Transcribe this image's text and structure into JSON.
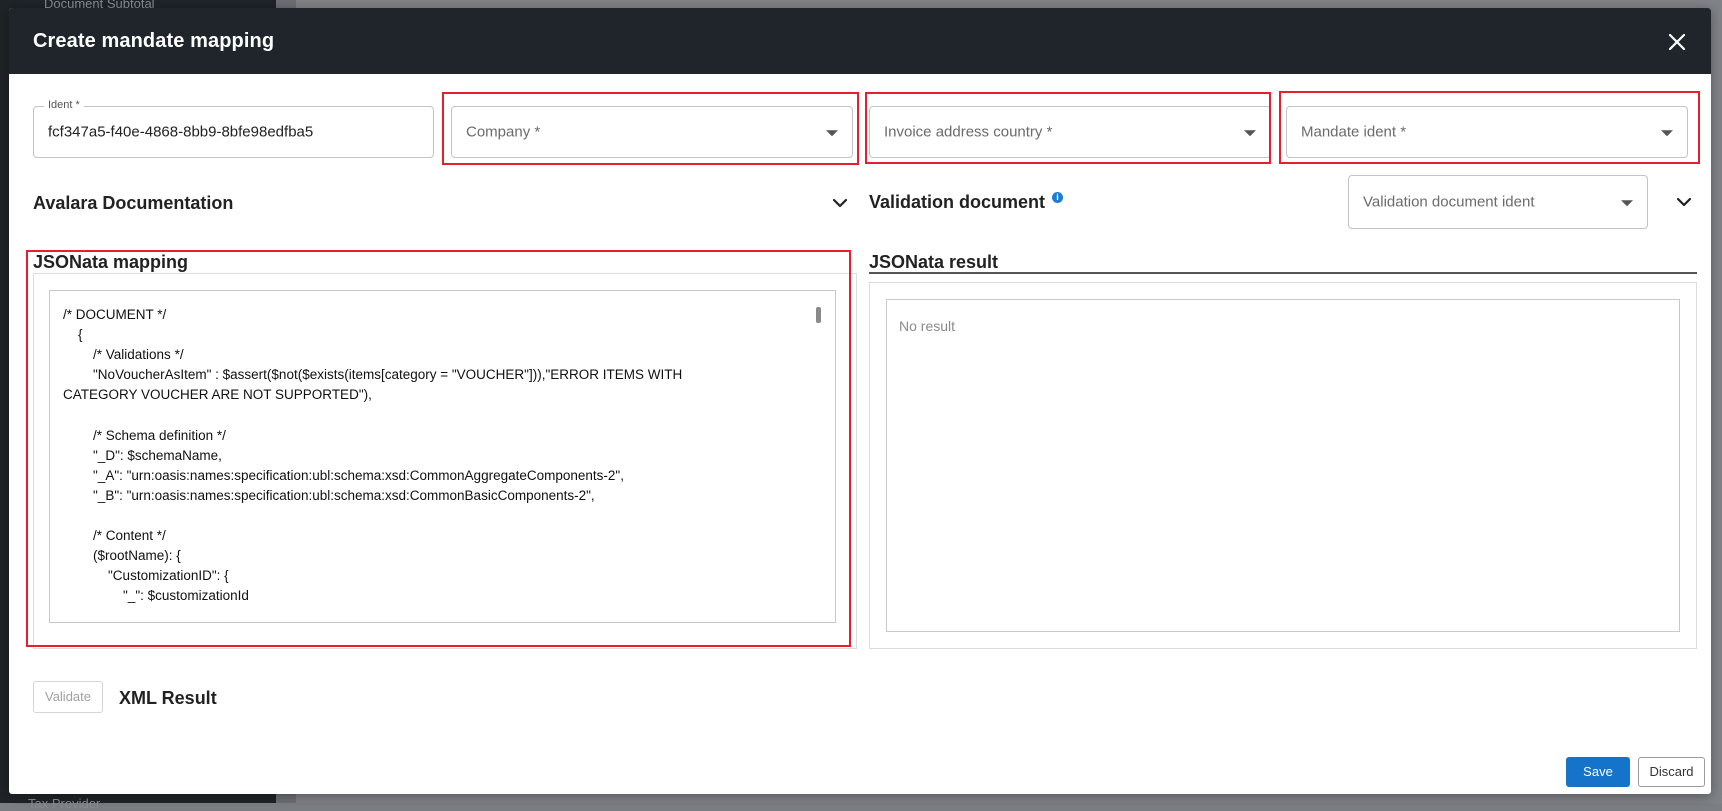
{
  "background": {
    "sidebar_top_text": "Document Subtotal",
    "sidebar_bottom_text": "Tax Provider"
  },
  "modal": {
    "title": "Create mandate mapping",
    "close_icon": "close-icon"
  },
  "fields": {
    "ident": {
      "label": "Ident *",
      "value": "fcf347a5-f40e-4868-8bb9-8bfe98edfba5"
    },
    "company": {
      "placeholder": "Company *"
    },
    "invoice_address_country": {
      "placeholder": "Invoice address country *"
    },
    "mandate_ident": {
      "placeholder": "Mandate ident *"
    },
    "validation_document_ident": {
      "placeholder": "Validation document ident"
    }
  },
  "sections": {
    "avalara_documentation": "Avalara Documentation",
    "validation_document": "Validation document",
    "jsonata_mapping": "JSONata mapping",
    "jsonata_result": "JSONata result",
    "xml_result": "XML Result"
  },
  "editor": {
    "lines": [
      "/* DOCUMENT */",
      "    {",
      "        /* Validations */",
      "        \"NoVoucherAsItem\" : $assert($not($exists(items[category = \"VOUCHER\"])),\"ERROR ITEMS WITH",
      "CATEGORY VOUCHER ARE NOT SUPPORTED\"),",
      "",
      "        /* Schema definition */",
      "        \"_D\": $schemaName,",
      "        \"_A\": \"urn:oasis:names:specification:ubl:schema:xsd:CommonAggregateComponents-2\",",
      "        \"_B\": \"urn:oasis:names:specification:ubl:schema:xsd:CommonBasicComponents-2\",",
      "",
      "        /* Content */",
      "        ($rootName): {",
      "            \"CustomizationID\": {",
      "                \"_\": $customizationId"
    ]
  },
  "result": {
    "placeholder": "No result"
  },
  "buttons": {
    "validate": "Validate",
    "save": "Save",
    "discard": "Discard"
  },
  "colors": {
    "header_bg": "#1f252b",
    "highlight": "#e5202e",
    "primary": "#1573c9"
  }
}
